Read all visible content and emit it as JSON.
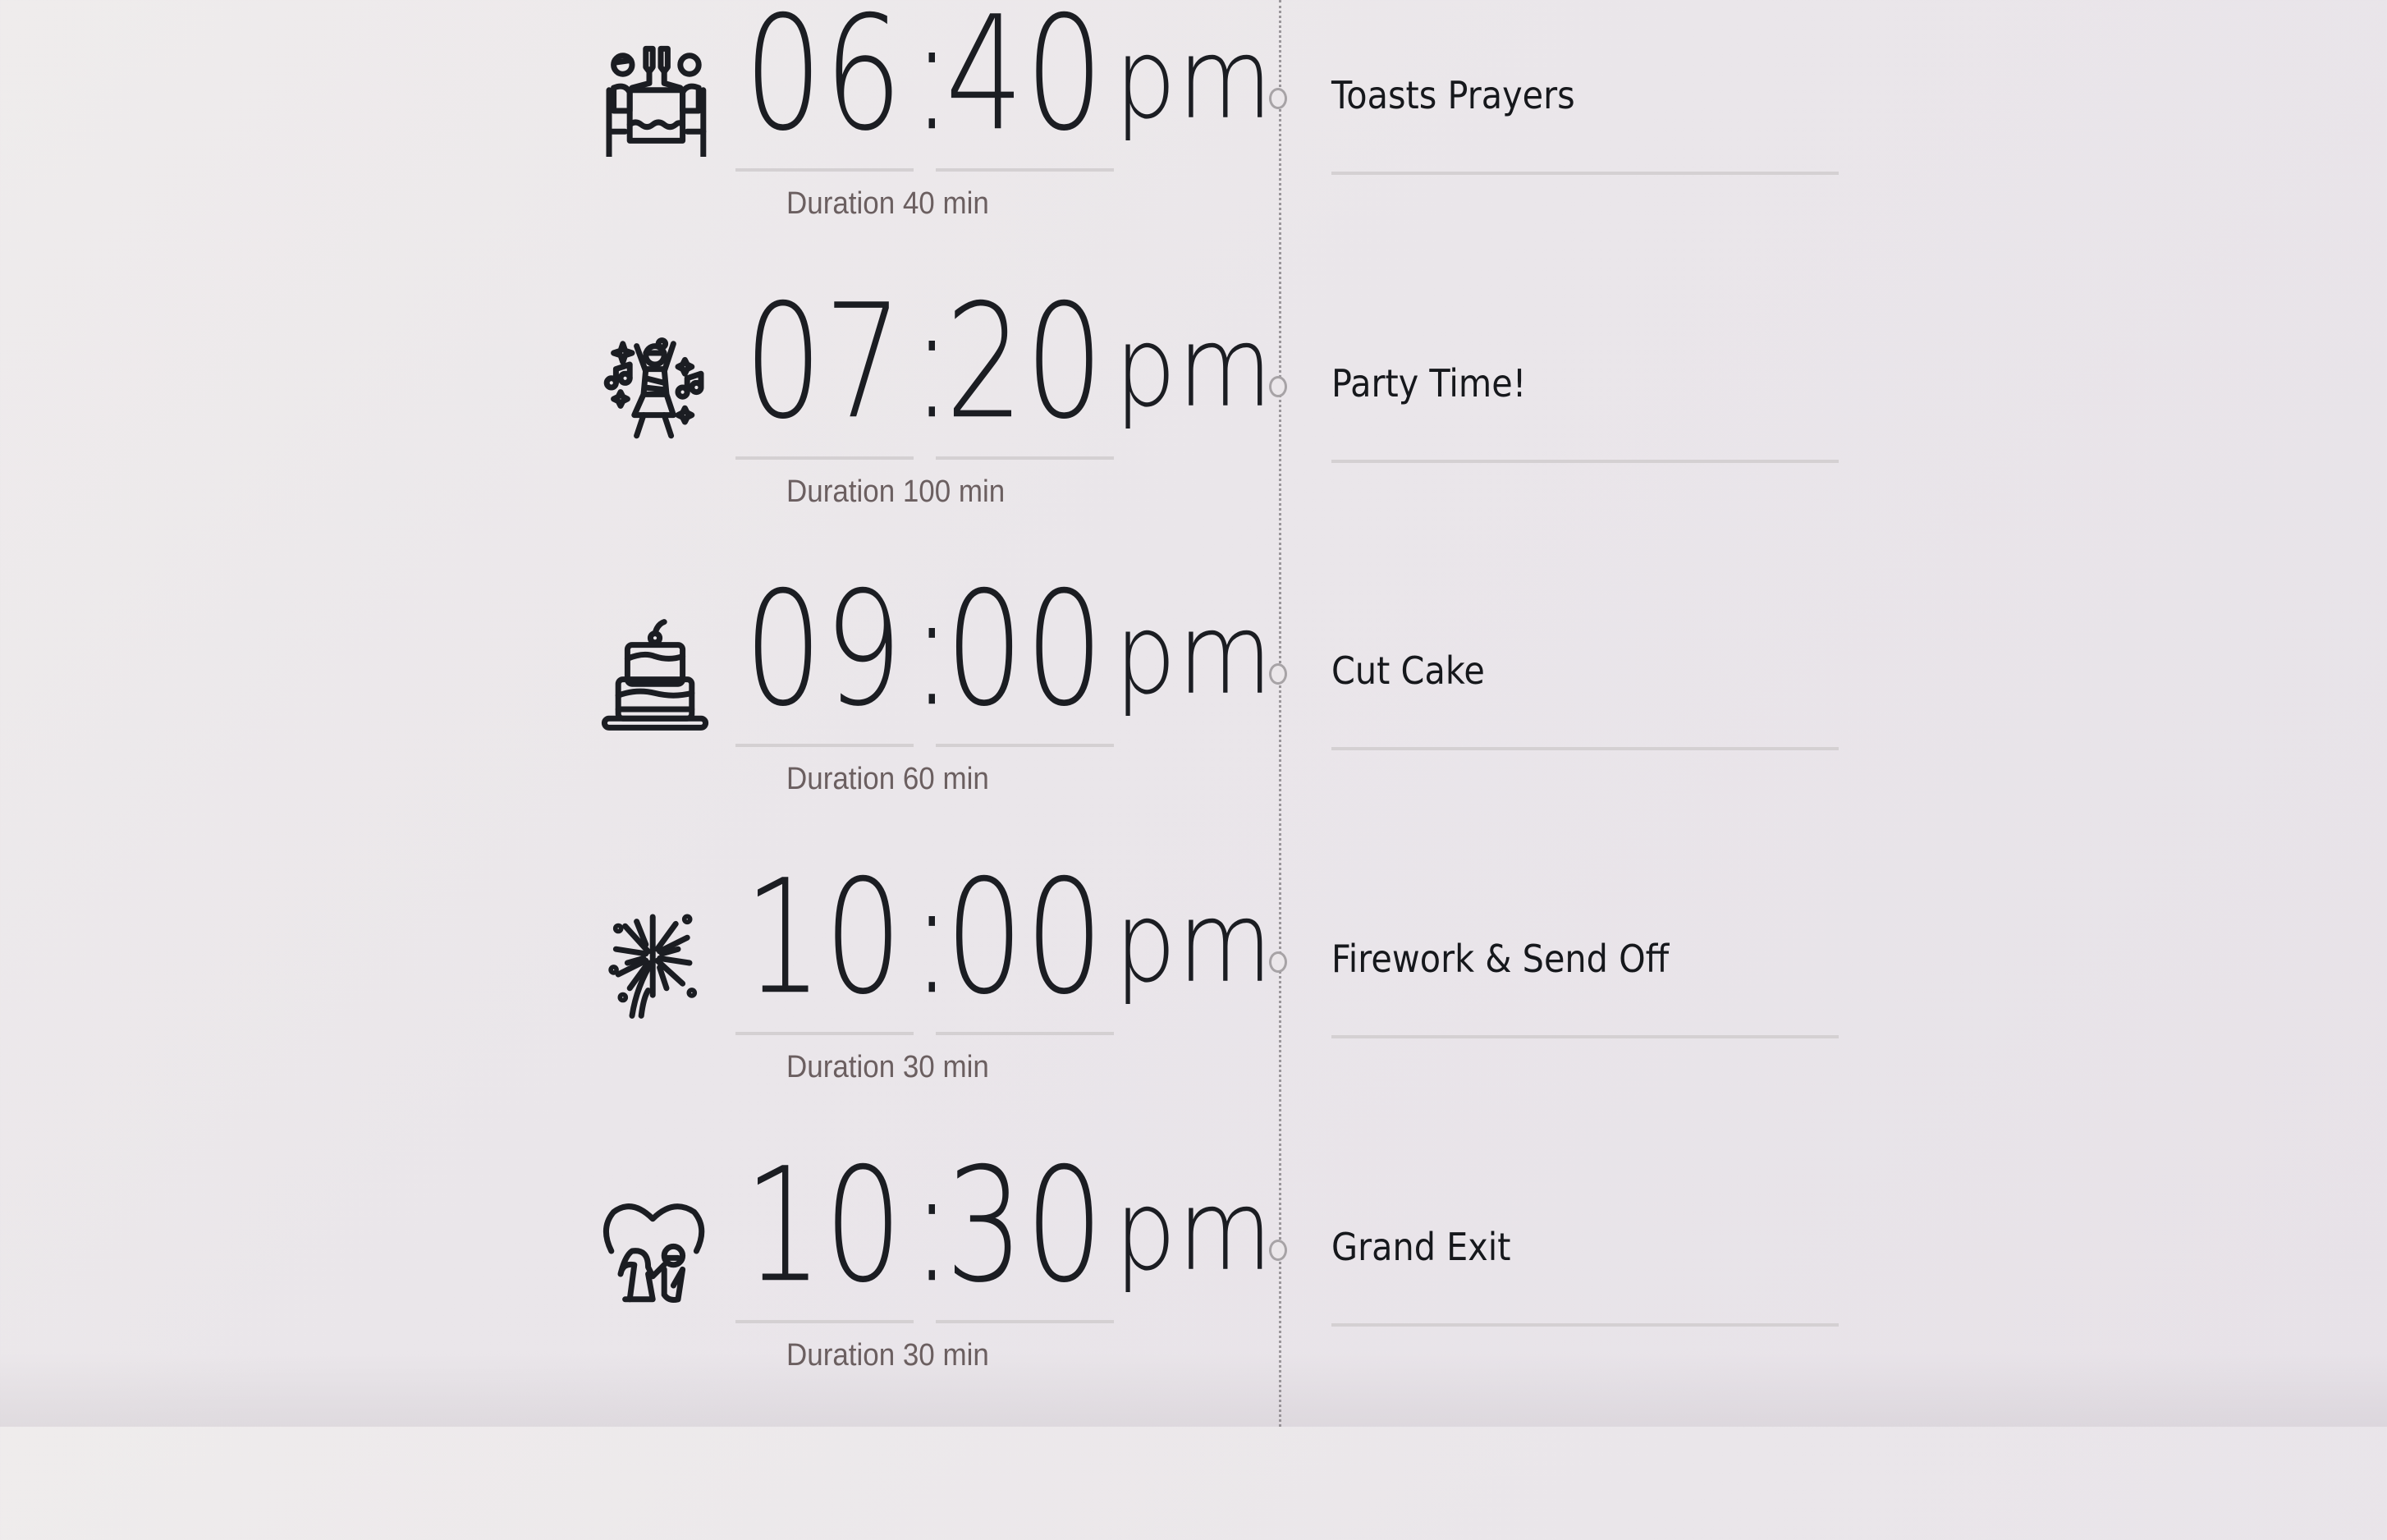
{
  "schedule": [
    {
      "icon": "toast-dinner-icon",
      "hours": "06",
      "minutes": "40",
      "ampm": "pm",
      "duration": "Duration 40 min",
      "title": "Toasts Prayers"
    },
    {
      "icon": "dancing-party-icon",
      "hours": "07",
      "minutes": "20",
      "ampm": "pm",
      "duration": "Duration 100 min",
      "title": "Party Time!"
    },
    {
      "icon": "wedding-cake-icon",
      "hours": "09",
      "minutes": "00",
      "ampm": "pm",
      "duration": "Duration 60 min",
      "title": "Cut Cake"
    },
    {
      "icon": "firework-icon",
      "hours": "10",
      "minutes": "00",
      "ampm": "pm",
      "duration": "Duration 30 min",
      "title": "Firework & Send Off"
    },
    {
      "icon": "couple-heart-icon",
      "hours": "10",
      "minutes": "30",
      "ampm": "pm",
      "duration": "Duration 30 min",
      "title": "Grand Exit"
    }
  ],
  "separator": ":",
  "colors": {
    "text": "#1b1d22",
    "duration": "#6b5f60",
    "underline": "#d4d0d2",
    "timeline": "#9a969a"
  }
}
